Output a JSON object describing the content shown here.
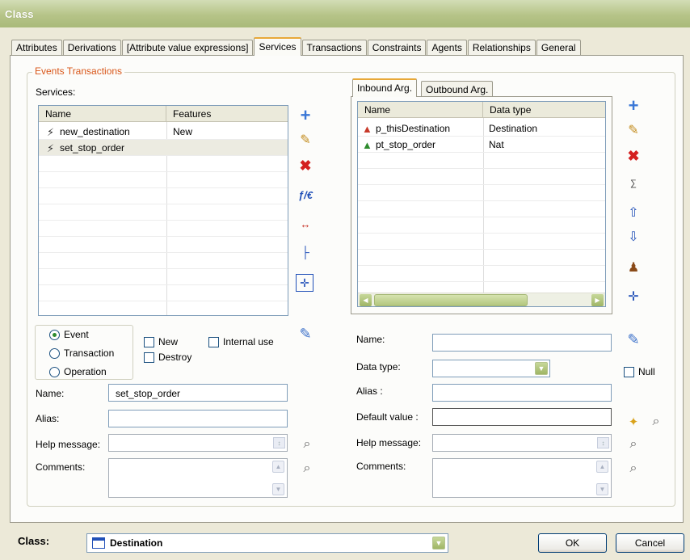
{
  "window": {
    "title": "Class"
  },
  "tabs": [
    {
      "label": "Attributes"
    },
    {
      "label": "Derivations"
    },
    {
      "label": "[Attribute value expressions]"
    },
    {
      "label": "Services",
      "active": true
    },
    {
      "label": "Transactions"
    },
    {
      "label": "Constraints"
    },
    {
      "label": "Agents"
    },
    {
      "label": "Relationships"
    },
    {
      "label": "General"
    }
  ],
  "group": {
    "legend": "Events Transactions"
  },
  "services": {
    "label": "Services:",
    "columns": [
      "Name",
      "Features"
    ],
    "rows": [
      {
        "name": "new_destination",
        "features": "New",
        "icon": "lightning-icon"
      },
      {
        "name": "set_stop_order",
        "features": "",
        "icon": "lightning-icon",
        "selected": true
      }
    ],
    "toolbar_icons": [
      "add-icon",
      "edit-icon",
      "delete-icon",
      "formula-icon",
      "rename-icon",
      "tree-icon",
      "move-icon"
    ]
  },
  "service_type": {
    "options": [
      "Event",
      "Transaction",
      "Operation"
    ],
    "selected": "Event",
    "flags": [
      {
        "label": "New",
        "checked": false
      },
      {
        "label": "Destroy",
        "checked": false
      },
      {
        "label": "Internal use",
        "checked": false
      }
    ]
  },
  "service_form": {
    "name_label": "Name:",
    "name_value": "set_stop_order",
    "alias_label": "Alias:",
    "alias_value": "",
    "help_label": "Help message:",
    "help_value": "",
    "comments_label": "Comments:",
    "comments_value": ""
  },
  "args": {
    "tabs": [
      "Inbound Arg.",
      "Outbound Arg."
    ],
    "active_tab": "Inbound Arg.",
    "columns": [
      "Name",
      "Data type"
    ],
    "rows": [
      {
        "name": "p_thisDestination",
        "type": "Destination",
        "icon": "object-arg-icon"
      },
      {
        "name": "pt_stop_order",
        "type": "Nat",
        "icon": "data-arg-icon"
      }
    ],
    "toolbar_icons": [
      "add-icon",
      "edit-icon",
      "delete-icon",
      "expression-icon",
      "move-up-icon",
      "move-down-icon",
      "person-icon",
      "move-icon"
    ]
  },
  "arg_form": {
    "name_label": "Name:",
    "name_value": "",
    "type_label": "Data type:",
    "type_value": "",
    "null_label": "Null",
    "null_checked": false,
    "alias_label": "Alias :",
    "alias_value": "",
    "default_label": "Default value :",
    "default_value": "",
    "help_label": "Help message:",
    "help_value": "",
    "comments_label": "Comments:",
    "comments_value": ""
  },
  "footer": {
    "class_label": "Class:",
    "class_value": "Destination",
    "ok_label": "OK",
    "cancel_label": "Cancel"
  },
  "colors": {
    "title_bar": "#b6c488",
    "legend": "#d9571a",
    "active_tab_accent": "#e8a838"
  }
}
